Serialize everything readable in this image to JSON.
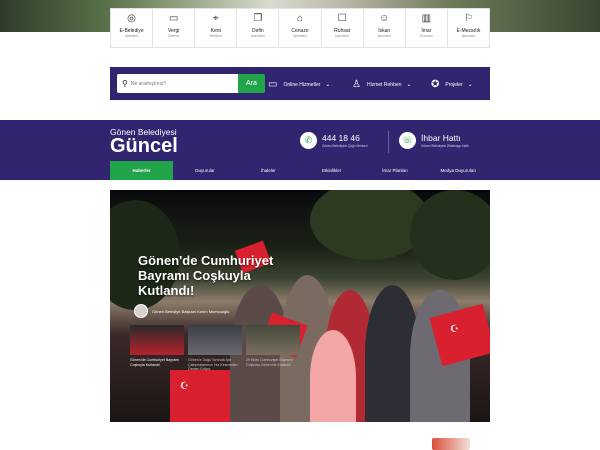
{
  "quick_links": [
    {
      "title": "E-Belediye",
      "subtitle": "İşlemleri",
      "icon": "globe-icon"
    },
    {
      "title": "Vergi",
      "subtitle": "Ödeme",
      "icon": "credit-card-icon"
    },
    {
      "title": "Kent",
      "subtitle": "Rehberi",
      "icon": "location-pin-icon"
    },
    {
      "title": "Defin",
      "subtitle": "İşlemleri",
      "icon": "document-icon"
    },
    {
      "title": "Cenaze",
      "subtitle": "İşlemleri",
      "icon": "folder-icon"
    },
    {
      "title": "Ruhsat",
      "subtitle": "İşlemleri",
      "icon": "certificate-icon"
    },
    {
      "title": "İskan",
      "subtitle": "İşlemleri",
      "icon": "user-icon"
    },
    {
      "title": "İmar",
      "subtitle": "Durumu",
      "icon": "building-icon"
    },
    {
      "title": "E-Mezarlık",
      "subtitle": "İşlemleri",
      "icon": "bookmark-icon"
    }
  ],
  "search": {
    "placeholder": "Ne aramıştınız?",
    "button_label": "Ara"
  },
  "top_menu": [
    {
      "label": "Online Hizmetler",
      "icon": "card-icon"
    },
    {
      "label": "Hizmet Rehberi",
      "icon": "person-icon"
    },
    {
      "label": "Projeler",
      "icon": "star-badge-icon"
    }
  ],
  "section": {
    "brand_sub": "Gönen Belediyesi",
    "brand_main": "Güncel",
    "phone": "444 18 46",
    "phone_note": "Gönen Belediyesi Çağrı Merkezi",
    "tip_line": "İhbar Hattı",
    "tip_note": "Gönen Belediyesi Whatsapp Hattı"
  },
  "tabs": [
    {
      "label": "Haberler",
      "active": true
    },
    {
      "label": "Duyurular",
      "active": false
    },
    {
      "label": "İhaleler",
      "active": false
    },
    {
      "label": "Etkinlikler",
      "active": false
    },
    {
      "label": "İmar Planları",
      "active": false
    },
    {
      "label": "Medya Duyuruları",
      "active": false
    }
  ],
  "featured": {
    "headline": "Gönen'de Cumhuriyet Bayramı Coşkuyla Kutlandı!",
    "author": "Gönen Belediye Başkanı Kerim Mumcuoğlu",
    "thumbnails": [
      {
        "caption": "Gönen'de Cumhuriyet Bayramı Coşkuyla Kutlandı!"
      },
      {
        "caption": "Gönen'e Doğu Sırtında İçin Çalışmalarımızı Hız Kesmeden Devam Ediyor"
      },
      {
        "caption": "29 Ekim Cumhuriyet Bayramı Coşkusu Gönen'de Kutlandı"
      }
    ]
  },
  "colors": {
    "brand_purple": "#31256f",
    "accent_green": "#22a44a",
    "flag_red": "#d8202f"
  }
}
